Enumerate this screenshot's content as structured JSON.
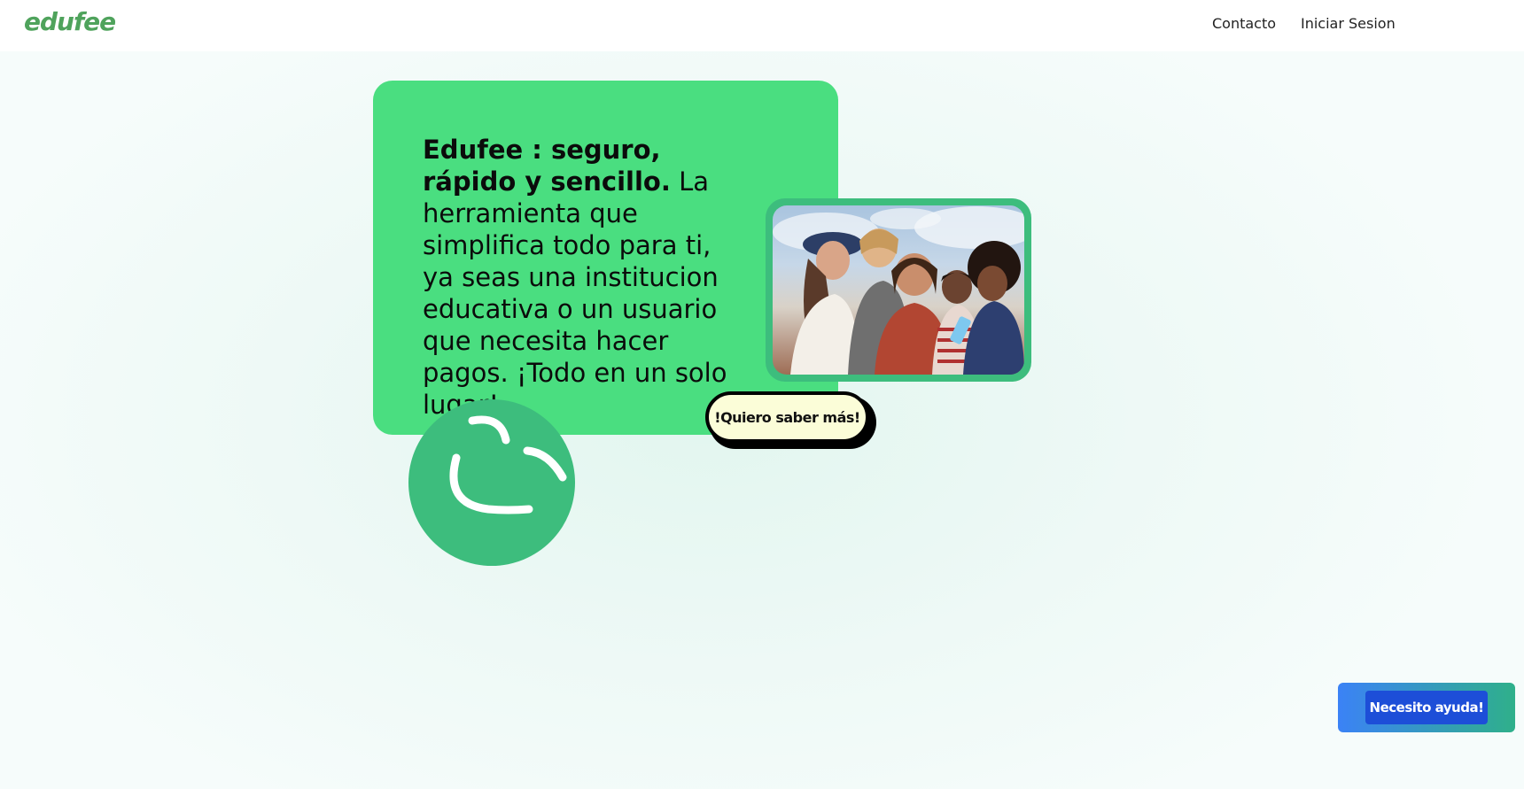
{
  "header": {
    "logo_text": "edufee",
    "nav": {
      "contact_label": "Contacto",
      "login_label": "Iniciar Sesion"
    }
  },
  "hero": {
    "headline_bold": "Edufee : seguro, rápido y sencillo.",
    "headline_rest": " La herramienta que simplifica todo para ti, ya seas una institucion educativa o un usuario que necesita hacer pagos. ¡Todo en un solo lugar!",
    "photo_icon": "group-of-friends-photo",
    "cta_label": "!Quiero saber más!",
    "decoration_icon": "smiley-icon"
  },
  "help": {
    "button_label": "Necesito ayuda!"
  },
  "colors": {
    "brand_green": "#4ade80",
    "accent_green": "#3dbd7d",
    "logo_green": "#4fa35c",
    "cta_background": "#fbfdd8",
    "help_blue": "#1d4ed8"
  }
}
